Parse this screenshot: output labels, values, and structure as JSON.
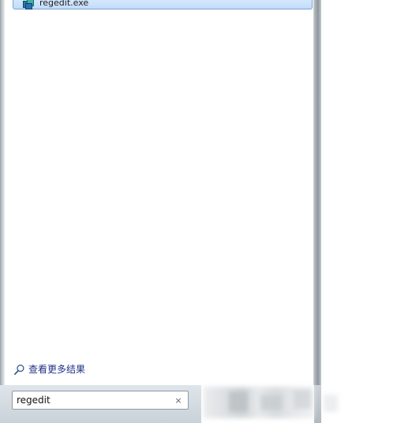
{
  "results": {
    "items": [
      {
        "label": "regedit.exe",
        "icon": "regedit-icon",
        "selected": true
      }
    ]
  },
  "more_results": {
    "label": "查看更多结果",
    "icon": "search-magnifier-icon"
  },
  "search": {
    "value": "regedit",
    "clear_icon": "clear-x-icon",
    "clear_glyph": "×"
  },
  "colors": {
    "selection_fill": "#c1dcfc",
    "selection_border": "#7da2ce",
    "link": "#1e3287",
    "frame": "#8e979e"
  }
}
